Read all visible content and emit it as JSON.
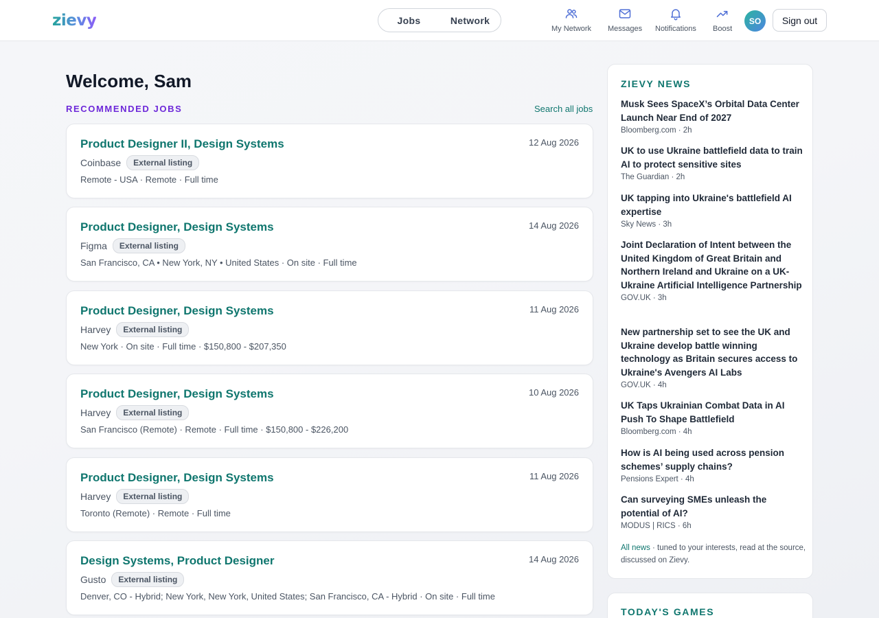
{
  "header": {
    "logo": "zievy",
    "toggle": [
      "Jobs",
      "Network"
    ],
    "nav": [
      {
        "label": "My Network",
        "icon": "people-icon"
      },
      {
        "label": "Messages",
        "icon": "mail-icon"
      },
      {
        "label": "Notifications",
        "icon": "bell-icon"
      },
      {
        "label": "Boost",
        "icon": "trending-up-icon"
      }
    ],
    "avatar_initials": "SO",
    "sign_out": "Sign out"
  },
  "main": {
    "welcome": "Welcome, Sam",
    "section_label": "RECOMMENDED JOBS",
    "search_all": "Search all jobs",
    "jobs": [
      {
        "title": "Product Designer II, Design Systems",
        "company": "Coinbase",
        "badge": "External listing",
        "meta": "Remote - USA · Remote · Full time",
        "date": "12 Aug 2026"
      },
      {
        "title": "Product Designer, Design Systems",
        "company": "Figma",
        "badge": "External listing",
        "meta": "San Francisco, CA • New York, NY • United States · On site · Full time",
        "date": "14 Aug 2026"
      },
      {
        "title": "Product Designer, Design Systems",
        "company": "Harvey",
        "badge": "External listing",
        "meta": "New York · On site · Full time · $150,800 - $207,350",
        "date": "11 Aug 2026"
      },
      {
        "title": "Product Designer, Design Systems",
        "company": "Harvey",
        "badge": "External listing",
        "meta": "San Francisco (Remote) · Remote · Full time · $150,800 - $226,200",
        "date": "10 Aug 2026"
      },
      {
        "title": "Product Designer, Design Systems",
        "company": "Harvey",
        "badge": "External listing",
        "meta": "Toronto (Remote) · Remote · Full time",
        "date": "11 Aug 2026"
      },
      {
        "title": "Design Systems, Product Designer",
        "company": "Gusto",
        "badge": "External listing",
        "meta": "Denver, CO - Hybrid; New York, New York, United States; San Francisco, CA - Hybrid · On site · Full time",
        "date": "14 Aug 2026"
      }
    ]
  },
  "sidebar": {
    "news_heading": "ZIEVY NEWS",
    "news": [
      {
        "title": "Musk Sees SpaceX’s Orbital Data Center Launch Near End of 2027",
        "source": "Bloomberg.com · 2h"
      },
      {
        "title": "UK to use Ukraine battlefield data to train AI to protect sensitive sites",
        "source": "The Guardian · 2h"
      },
      {
        "title": "UK tapping into Ukraine's battlefield AI expertise",
        "source": "Sky News · 3h"
      },
      {
        "title": "Joint Declaration of Intent between the United Kingdom of Great Britain and Northern Ireland and Ukraine on a UK-Ukraine Artificial Intelligence Partnership",
        "source": "GOV.UK · 3h"
      },
      {
        "title": "New partnership set to see the UK and Ukraine develop battle winning technology as Britain secures access to Ukraine's Avengers AI Labs",
        "source": "GOV.UK · 4h"
      },
      {
        "title": "UK Taps Ukrainian Combat Data in AI Push To Shape Battlefield",
        "source": "Bloomberg.com · 4h"
      },
      {
        "title": "How is AI being used across pension schemes’ supply chains?",
        "source": "Pensions Expert · 4h"
      },
      {
        "title": "Can surveying SMEs unleash the potential of AI?",
        "source": "MODUS | RICS · 6h"
      }
    ],
    "all_news": "All news",
    "footer_text": " · tuned to your interests, read at the source, discussed on Zievy.",
    "games_heading": "TODAY'S GAMES"
  }
}
